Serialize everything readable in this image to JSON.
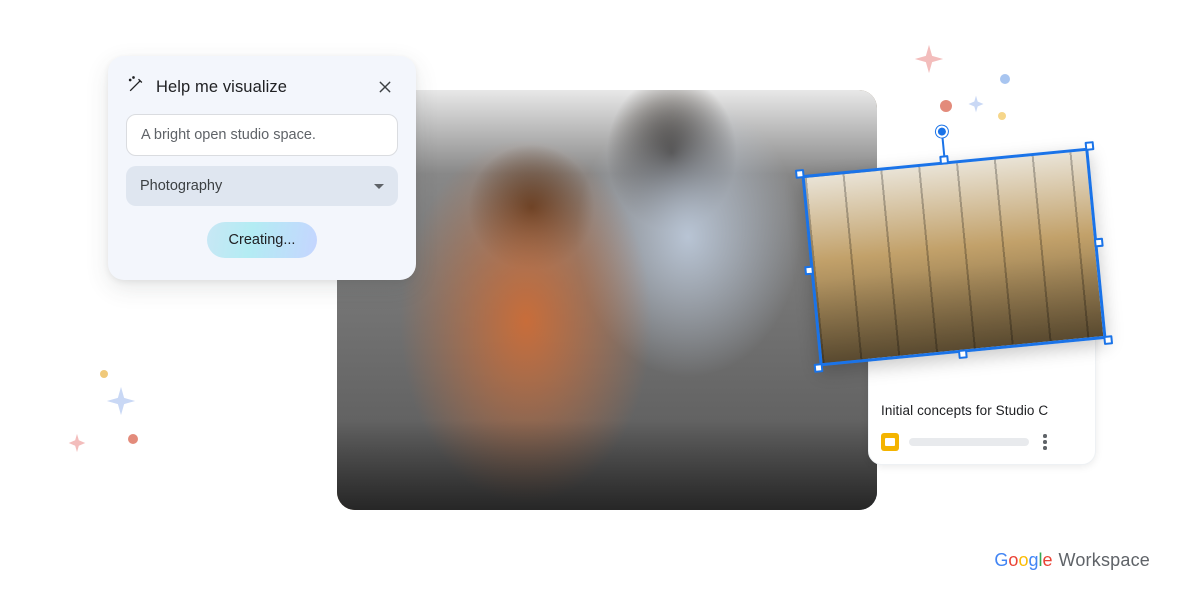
{
  "panel": {
    "title": "Help me visualize",
    "prompt_value": "A bright open studio space.",
    "style_selected": "Photography",
    "create_label": "Creating..."
  },
  "slides_card": {
    "title": "Initial concepts for Studio C"
  },
  "brand": {
    "google": "Google",
    "workspace": "Workspace"
  }
}
